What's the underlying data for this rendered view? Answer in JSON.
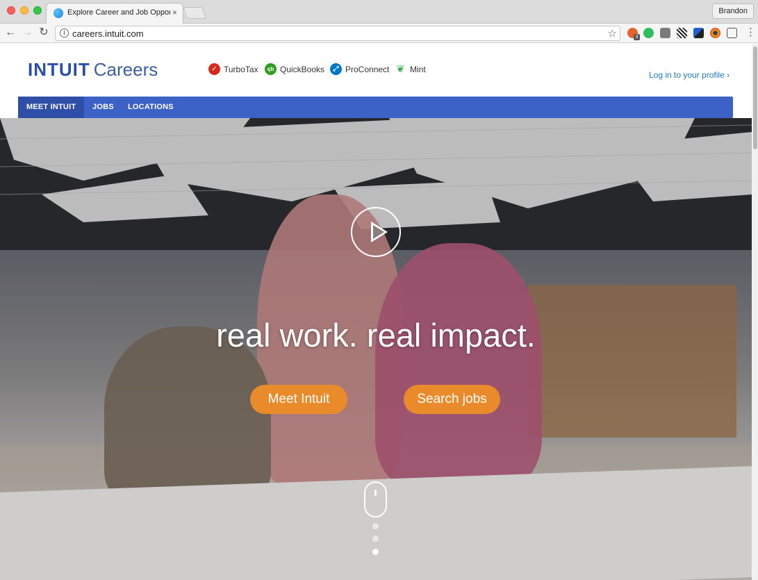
{
  "browser": {
    "tab_title": "Explore Career and Job Oppor",
    "tab_close": "×",
    "profile_name": "Brandon",
    "url": "careers.intuit.com",
    "info_glyph": "i",
    "star_glyph": "☆",
    "back_glyph": "←",
    "forward_glyph": "→",
    "reload_glyph": "↻",
    "menu_glyph": "⋮",
    "extension_badge": "3"
  },
  "header": {
    "logo_intuit": "INTUIT",
    "logo_careers": "Careers",
    "brands": [
      {
        "label": "TurboTax",
        "icon": "turbotax-icon",
        "glyph": "✓",
        "color": "#d52b1e"
      },
      {
        "label": "QuickBooks",
        "icon": "quickbooks-icon",
        "glyph": "qb",
        "color": "#2ca01c"
      },
      {
        "label": "ProConnect",
        "icon": "proconnect-icon",
        "glyph": "⤢",
        "color": "#0077c5"
      },
      {
        "label": "Mint",
        "icon": "mint-icon",
        "glyph": "❦",
        "color": "#3fb34f"
      }
    ],
    "login_text": "Log in to your profile ›"
  },
  "nav": {
    "items": [
      {
        "label": "MEET INTUIT",
        "active": true
      },
      {
        "label": "JOBS",
        "active": false
      },
      {
        "label": "LOCATIONS",
        "active": false
      }
    ]
  },
  "hero": {
    "headline": "real work. real impact.",
    "cta_meet": "Meet Intuit",
    "cta_search": "Search jobs",
    "carousel_active_index": 3,
    "carousel_count": 3
  },
  "colors": {
    "brand_blue": "#2b4fa8",
    "nav_blue": "#3c62c7",
    "nav_active": "#2e4ea8",
    "cta_orange": "#e98b2a",
    "link_blue": "#1d7bc1"
  }
}
